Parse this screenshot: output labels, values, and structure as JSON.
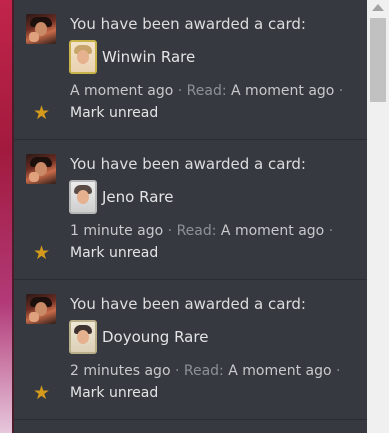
{
  "notifications": [
    {
      "title": "You have been awarded a card:",
      "card": "Winwin Rare",
      "time": "A moment ago",
      "sep1": " · Read: ",
      "read": "A moment ago",
      "sep2": " ·",
      "mark_unread": "Mark unread"
    },
    {
      "title": "You have been awarded a card:",
      "card": "Jeno Rare",
      "time": "1 minute ago",
      "sep1": " · Read: ",
      "read": "A moment ago",
      "sep2": " ·",
      "mark_unread": "Mark unread"
    },
    {
      "title": "You have been awarded a card:",
      "card": "Doyoung Rare",
      "time": "2 minutes ago",
      "sep1": " · Read: ",
      "read": "A moment ago",
      "sep2": " ·",
      "mark_unread": "Mark unread"
    }
  ],
  "colors": {
    "panel_bg": "#36393f",
    "star": "#d39a1b",
    "text_primary": "#dcddde",
    "text_muted": "#8e9297"
  },
  "icons": {
    "star": "star-icon",
    "avatar": "user-avatar",
    "card": "card-thumbnail"
  }
}
